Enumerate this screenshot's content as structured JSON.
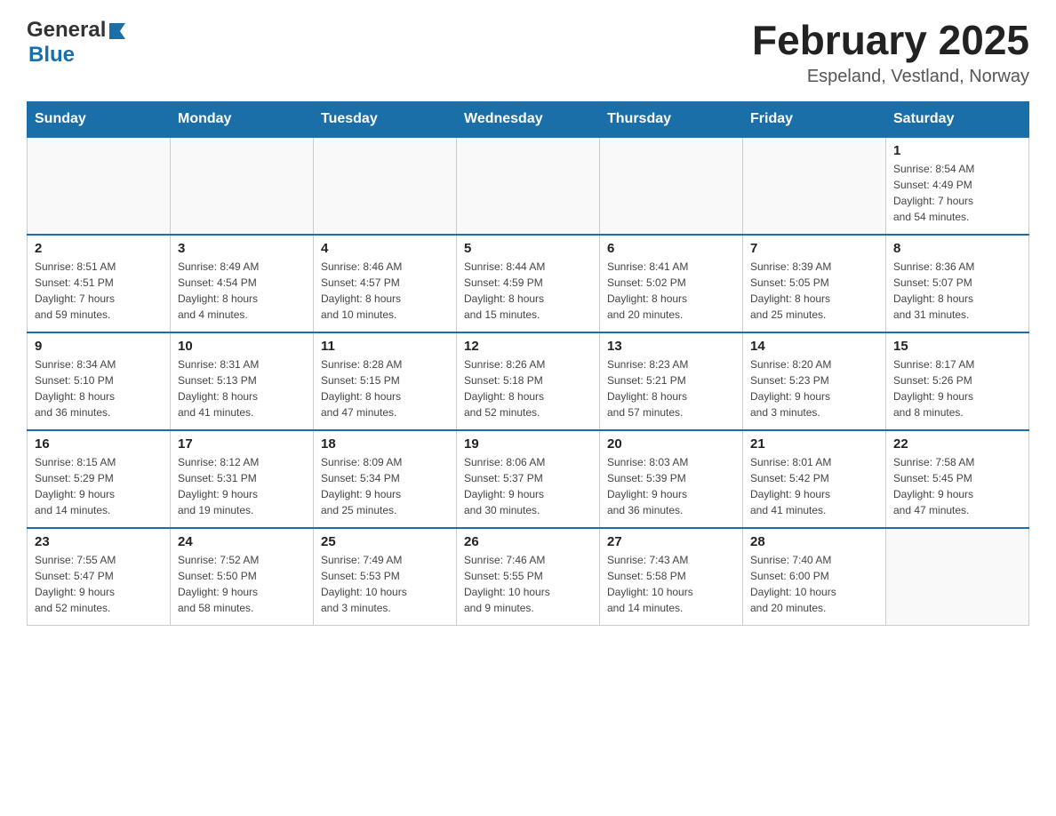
{
  "header": {
    "logo_general": "General",
    "logo_blue": "Blue",
    "month_title": "February 2025",
    "location": "Espeland, Vestland, Norway"
  },
  "weekdays": [
    "Sunday",
    "Monday",
    "Tuesday",
    "Wednesday",
    "Thursday",
    "Friday",
    "Saturday"
  ],
  "weeks": [
    [
      {
        "day": "",
        "info": ""
      },
      {
        "day": "",
        "info": ""
      },
      {
        "day": "",
        "info": ""
      },
      {
        "day": "",
        "info": ""
      },
      {
        "day": "",
        "info": ""
      },
      {
        "day": "",
        "info": ""
      },
      {
        "day": "1",
        "info": "Sunrise: 8:54 AM\nSunset: 4:49 PM\nDaylight: 7 hours\nand 54 minutes."
      }
    ],
    [
      {
        "day": "2",
        "info": "Sunrise: 8:51 AM\nSunset: 4:51 PM\nDaylight: 7 hours\nand 59 minutes."
      },
      {
        "day": "3",
        "info": "Sunrise: 8:49 AM\nSunset: 4:54 PM\nDaylight: 8 hours\nand 4 minutes."
      },
      {
        "day": "4",
        "info": "Sunrise: 8:46 AM\nSunset: 4:57 PM\nDaylight: 8 hours\nand 10 minutes."
      },
      {
        "day": "5",
        "info": "Sunrise: 8:44 AM\nSunset: 4:59 PM\nDaylight: 8 hours\nand 15 minutes."
      },
      {
        "day": "6",
        "info": "Sunrise: 8:41 AM\nSunset: 5:02 PM\nDaylight: 8 hours\nand 20 minutes."
      },
      {
        "day": "7",
        "info": "Sunrise: 8:39 AM\nSunset: 5:05 PM\nDaylight: 8 hours\nand 25 minutes."
      },
      {
        "day": "8",
        "info": "Sunrise: 8:36 AM\nSunset: 5:07 PM\nDaylight: 8 hours\nand 31 minutes."
      }
    ],
    [
      {
        "day": "9",
        "info": "Sunrise: 8:34 AM\nSunset: 5:10 PM\nDaylight: 8 hours\nand 36 minutes."
      },
      {
        "day": "10",
        "info": "Sunrise: 8:31 AM\nSunset: 5:13 PM\nDaylight: 8 hours\nand 41 minutes."
      },
      {
        "day": "11",
        "info": "Sunrise: 8:28 AM\nSunset: 5:15 PM\nDaylight: 8 hours\nand 47 minutes."
      },
      {
        "day": "12",
        "info": "Sunrise: 8:26 AM\nSunset: 5:18 PM\nDaylight: 8 hours\nand 52 minutes."
      },
      {
        "day": "13",
        "info": "Sunrise: 8:23 AM\nSunset: 5:21 PM\nDaylight: 8 hours\nand 57 minutes."
      },
      {
        "day": "14",
        "info": "Sunrise: 8:20 AM\nSunset: 5:23 PM\nDaylight: 9 hours\nand 3 minutes."
      },
      {
        "day": "15",
        "info": "Sunrise: 8:17 AM\nSunset: 5:26 PM\nDaylight: 9 hours\nand 8 minutes."
      }
    ],
    [
      {
        "day": "16",
        "info": "Sunrise: 8:15 AM\nSunset: 5:29 PM\nDaylight: 9 hours\nand 14 minutes."
      },
      {
        "day": "17",
        "info": "Sunrise: 8:12 AM\nSunset: 5:31 PM\nDaylight: 9 hours\nand 19 minutes."
      },
      {
        "day": "18",
        "info": "Sunrise: 8:09 AM\nSunset: 5:34 PM\nDaylight: 9 hours\nand 25 minutes."
      },
      {
        "day": "19",
        "info": "Sunrise: 8:06 AM\nSunset: 5:37 PM\nDaylight: 9 hours\nand 30 minutes."
      },
      {
        "day": "20",
        "info": "Sunrise: 8:03 AM\nSunset: 5:39 PM\nDaylight: 9 hours\nand 36 minutes."
      },
      {
        "day": "21",
        "info": "Sunrise: 8:01 AM\nSunset: 5:42 PM\nDaylight: 9 hours\nand 41 minutes."
      },
      {
        "day": "22",
        "info": "Sunrise: 7:58 AM\nSunset: 5:45 PM\nDaylight: 9 hours\nand 47 minutes."
      }
    ],
    [
      {
        "day": "23",
        "info": "Sunrise: 7:55 AM\nSunset: 5:47 PM\nDaylight: 9 hours\nand 52 minutes."
      },
      {
        "day": "24",
        "info": "Sunrise: 7:52 AM\nSunset: 5:50 PM\nDaylight: 9 hours\nand 58 minutes."
      },
      {
        "day": "25",
        "info": "Sunrise: 7:49 AM\nSunset: 5:53 PM\nDaylight: 10 hours\nand 3 minutes."
      },
      {
        "day": "26",
        "info": "Sunrise: 7:46 AM\nSunset: 5:55 PM\nDaylight: 10 hours\nand 9 minutes."
      },
      {
        "day": "27",
        "info": "Sunrise: 7:43 AM\nSunset: 5:58 PM\nDaylight: 10 hours\nand 14 minutes."
      },
      {
        "day": "28",
        "info": "Sunrise: 7:40 AM\nSunset: 6:00 PM\nDaylight: 10 hours\nand 20 minutes."
      },
      {
        "day": "",
        "info": ""
      }
    ]
  ]
}
